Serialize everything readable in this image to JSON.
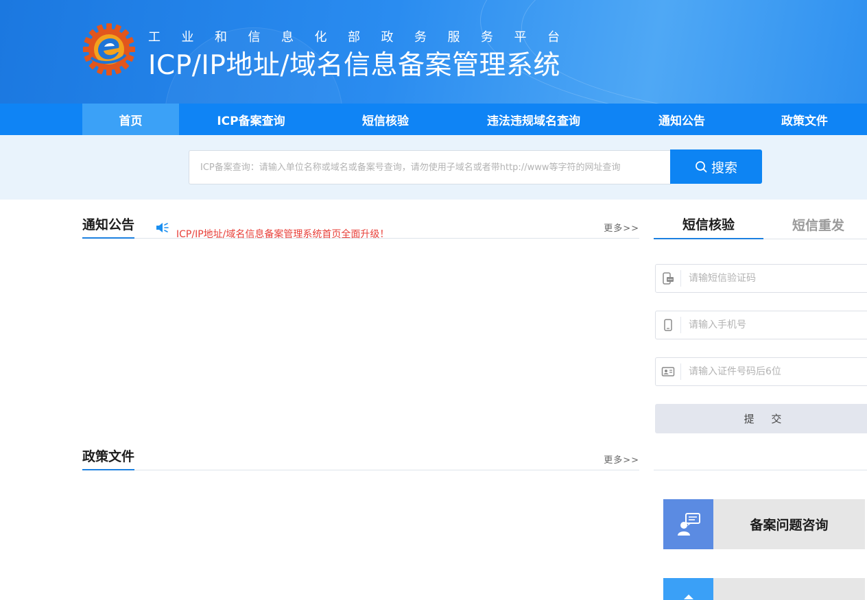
{
  "header": {
    "subtitle": "工业和信息化部政务服务平台",
    "title": "ICP/IP地址/域名信息备案管理系统"
  },
  "nav": {
    "items": [
      {
        "label": "首页",
        "active": true
      },
      {
        "label": "ICP备案查询"
      },
      {
        "label": "短信核验"
      },
      {
        "label": "违法违规域名查询"
      },
      {
        "label": "通知公告"
      },
      {
        "label": "政策文件"
      }
    ]
  },
  "search": {
    "placeholder": "ICP备案查询：请输入单位名称或域名或备案号查询，请勿使用子域名或者带http://www等字符的网址查询",
    "button_label": "搜索"
  },
  "notice": {
    "title": "通知公告",
    "more": "更多>>",
    "scroll_text": "ICP/IP地址/域名信息备案管理系统首页全面升级！"
  },
  "policy": {
    "title": "政策文件",
    "more": "更多>>"
  },
  "sms": {
    "tabs": [
      {
        "label": "短信核验",
        "active": true
      },
      {
        "label": "短信重发"
      }
    ],
    "code_placeholder": "请输短信验证码",
    "phone_placeholder": "请输入手机号",
    "id_placeholder": "请输入证件号码后6位",
    "submit_label": "提 交"
  },
  "consult": {
    "card1_label": "备案问题咨询"
  },
  "colors": {
    "nav_bg": "#0f84f5",
    "nav_active": "#3ba1f7",
    "accent": "#1b7fe0",
    "notice_red": "#e8403a",
    "search_strip": "#e9f3fc"
  }
}
